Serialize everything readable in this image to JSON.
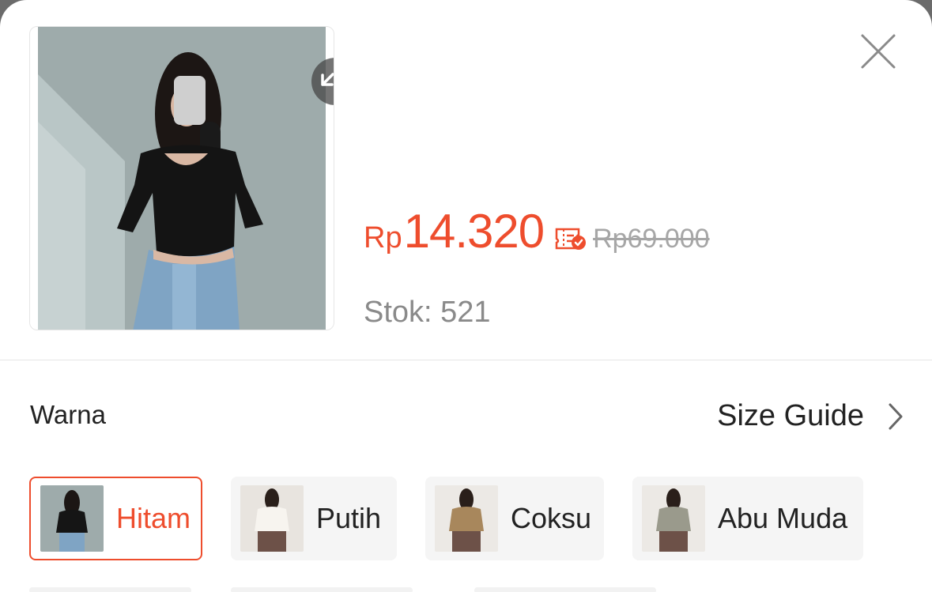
{
  "product": {
    "currency": "Rp",
    "price": "14.320",
    "original_price": "Rp69.000",
    "stock_text": "Stok: 521"
  },
  "variation": {
    "title": "Warna",
    "size_guide_label": "Size Guide",
    "selected": "Hitam",
    "options": [
      {
        "label": "Hitam",
        "garment_color": "#151515",
        "selected": true
      },
      {
        "label": "Putih",
        "garment_color": "#f3efe8",
        "selected": false
      },
      {
        "label": "Coksu",
        "garment_color": "#a8875c",
        "selected": false
      },
      {
        "label": "Abu Muda",
        "garment_color": "#9a9a8c",
        "selected": false
      }
    ]
  },
  "icons": {
    "expand": "expand-icon",
    "close": "close-icon",
    "voucher": "voucher-icon",
    "size_guide_arrow": "chevron-right-icon"
  },
  "colors": {
    "accent": "#ee4d2d",
    "muted_text": "#8a8a8a",
    "strike_text": "#a6a6a6"
  }
}
